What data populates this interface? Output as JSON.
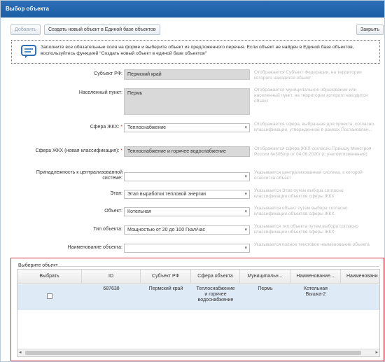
{
  "window": {
    "title": "Выбор объекта"
  },
  "toolbar": {
    "add_label": "Добавить",
    "create_label": "Создать новый объект в Единой базе объектов",
    "close_label": "Закрыть"
  },
  "info": {
    "text": "Заполните все обязательные поля на форме и выберите объект из предложенного перечня. Если объект не найден в Единой базе объектов, воспользуйтесь функцией \"Создать новый объект в единой базе объектов\""
  },
  "form": {
    "subject": {
      "label": "Субъект РФ:",
      "value": "Пермский край",
      "hint": "Отображается Субъект Федерации, на территории которого находится объект"
    },
    "locality": {
      "label": "Населенный пункт:",
      "value": "Пермь",
      "hint": "Отображается муниципальное образование или населенный пункт, на территории которого находится объект"
    },
    "sphere": {
      "label": "Сфера ЖКХ:",
      "value": "Теплоснабжение",
      "hint": "Отображается сфера, выбранная для проекта, согласно классификации, утвержденной в рамках Постановлен..."
    },
    "sphere_new": {
      "label": "Сфера ЖКХ (новая классификация):",
      "value": "Теплоснабжение и горячее водоснабжение",
      "hint": "Отображается сфера ЖКХ согласно Приказу Минстроя России №305/пр от 04.06.2020г (с учетом изменений)"
    },
    "centralized": {
      "label_line1": "Принадлежность к централизованной",
      "label_line2": "системе:",
      "value": "",
      "hint": "Указывается централизованная система, к которой относится объект"
    },
    "stage": {
      "label": "Этап:",
      "value": "Этап выработки тепловой энергии",
      "hint": "Указывается Этап путем выбора согласно классификации объектов сферы ЖКХ"
    },
    "object": {
      "label": "Объект:",
      "value": "Котельная",
      "hint": "Указывается объект путем выбора согласно классификации объектов сферы ЖКХ"
    },
    "object_type": {
      "label": "Тип объекта:",
      "value": "Мощностью от 20 до 100 Гкал/час",
      "hint": "Указывается тип объекта путем выбора согласно классификации объектов сферы ЖКХ"
    },
    "object_name": {
      "label": "Наименование объекта:",
      "value": "",
      "hint": "Указывается полное текстовое наименование объекта"
    }
  },
  "grid": {
    "title": "Выберите объект",
    "columns": [
      "Выбрать",
      "ID",
      "Субъект РФ",
      "Сфера объекта",
      "Муниципальн...",
      "Наименование...",
      "Наименовани"
    ],
    "rows": [
      {
        "id": "687638",
        "subject": "Пермский край",
        "sphere_l1": "Теплоснабжение",
        "sphere_l2": "и горячее",
        "sphere_l3": "водоснабжение",
        "municipality": "Пермь",
        "name_l1": "Котельная",
        "name_l2": "Вышка-2",
        "selected": false
      }
    ]
  },
  "colors": {
    "title_bar": "#1d5ea6",
    "grid_border": "#cf2d3f",
    "row_highlight": "#dfeaf7",
    "info_icon": "#2b6fb6"
  }
}
